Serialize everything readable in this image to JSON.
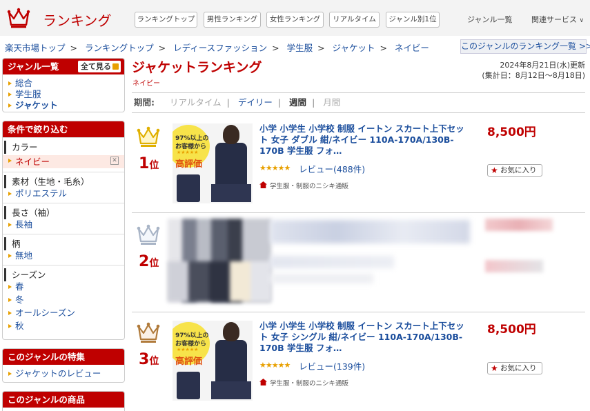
{
  "header": {
    "logo_text": "ランキング",
    "buttons": [
      "ランキングトップ",
      "男性ランキング",
      "女性ランキング",
      "リアルタイム",
      "ジャンル別1位"
    ],
    "links": [
      "ジャンル一覧",
      "関連サービス"
    ]
  },
  "breadcrumb": [
    "楽天市場トップ",
    "ランキングトップ",
    "レディースファッション",
    "学生服",
    "ジャケット",
    "ネイビー"
  ],
  "genre_list_link": "このジャンルのランキング一覧 >>",
  "sidebar": {
    "genre_head": "ジャンル一覧",
    "see_all": "全て見る",
    "genres": [
      "総合",
      "学生服",
      "ジャケット"
    ],
    "filter_head": "条件で絞り込む",
    "filters": [
      {
        "title": "カラー",
        "items": [
          "ネイビー"
        ],
        "selected": "ネイビー"
      },
      {
        "title": "素材（生地・毛糸）",
        "items": [
          "ポリエステル"
        ]
      },
      {
        "title": "長さ（袖）",
        "items": [
          "長袖"
        ]
      },
      {
        "title": "柄",
        "items": [
          "無地"
        ]
      },
      {
        "title": "シーズン",
        "items": [
          "春",
          "冬",
          "オールシーズン",
          "秋"
        ]
      }
    ],
    "feature_head": "このジャンルの特集",
    "feature_items": [
      "ジャケットのレビュー"
    ],
    "products_head": "このジャンルの商品"
  },
  "main": {
    "title": "ジャケットランキング",
    "subtitle": "ネイビー",
    "updated": "2024年8月21日(水)更新",
    "period_range": "(集計日：8月12日～8月18日)",
    "period_label": "期間:",
    "periods": [
      "リアルタイム",
      "デイリー",
      "週間",
      "月間"
    ]
  },
  "items": [
    {
      "rank": "1",
      "rank_suffix": "位",
      "title": "小学 小学生 小学校 制服 イートン スカート上下セット 女子 ダブル 紺/ネイビー 110A-170A/130B-170B 学生服 フォ…",
      "stars": "★★★★★",
      "review": "レビュー(488件)",
      "shop": "学生服・制服のニシキ通販",
      "price": "8,500円",
      "fav": "お気に入り",
      "thumb_badge_top": "97%以上の",
      "thumb_badge_mid": "お客様から",
      "thumb_badge_bottom": "高評価"
    },
    {
      "rank": "2",
      "rank_suffix": "位"
    },
    {
      "rank": "3",
      "rank_suffix": "位",
      "title": "小学 小学生 小学校 制服 イートン スカート上下セット 女子 シングル 紺/ネイビー 110A-170A/130B-170B 学生服 フォ…",
      "stars": "★★★★★",
      "review": "レビュー(139件)",
      "shop": "学生服・制服のニシキ通販",
      "price": "8,500円",
      "fav": "お気に入り",
      "thumb_badge_top": "97%以上の",
      "thumb_badge_mid": "お客様から",
      "thumb_badge_bottom": "高評価"
    }
  ],
  "colors": {
    "accent": "#bf0000",
    "link": "#1a4d9c",
    "gold": "#e8a000"
  }
}
